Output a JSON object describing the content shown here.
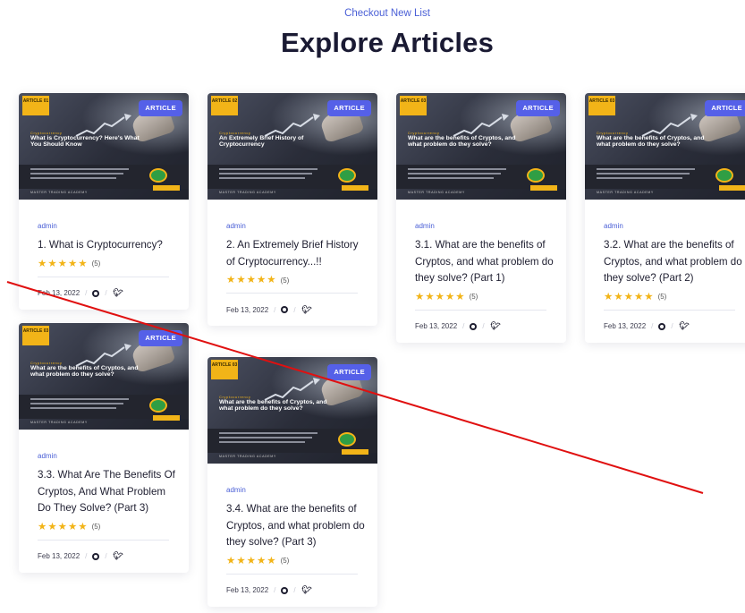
{
  "header": {
    "kicker": "Checkout New List",
    "title": "Explore Articles"
  },
  "colors": {
    "accent": "#4a5fd6",
    "badge": "#5560e8",
    "star": "#f2b418",
    "annotation_line": "#e01010"
  },
  "cards": [
    {
      "thumb": {
        "num": "ARTICLE 01",
        "badge": "ARTICLE",
        "kicker": "Cryptocurrency",
        "title": "What is Cryptocurrency? Here's What You Should Know",
        "footer": "MASTER TRADING ACADEMY"
      },
      "author": "admin",
      "title": "1. What is Cryptocurrency?",
      "rating_count": "(5)",
      "date": "Feb 13, 2022"
    },
    {
      "thumb": {
        "num": "ARTICLE 02",
        "badge": "ARTICLE",
        "kicker": "Cryptocurrency",
        "title": "An Extremely Brief History of Cryptocurrency",
        "footer": "MASTER TRADING ACADEMY"
      },
      "author": "admin",
      "title": "2. An Extremely Brief History of Cryptocurrency...!!",
      "rating_count": "(5)",
      "date": "Feb 13, 2022"
    },
    {
      "thumb": {
        "num": "ARTICLE 03",
        "badge": "ARTICLE",
        "kicker": "Cryptocurrency",
        "title": "What are the benefits of Cryptos, and what problem do they solve?",
        "footer": "MASTER TRADING ACADEMY"
      },
      "author": "admin",
      "title": "3.1. What are the benefits of Cryptos, and what problem do they solve? (Part 1)",
      "rating_count": "(5)",
      "date": "Feb 13, 2022"
    },
    {
      "thumb": {
        "num": "ARTICLE 03",
        "badge": "ARTICLE",
        "kicker": "Cryptocurrency",
        "title": "What are the benefits of Cryptos, and what problem do they solve?",
        "footer": "MASTER TRADING ACADEMY"
      },
      "author": "admin",
      "title": "3.2. What are the benefits of Cryptos, and what problem do they solve? (Part 2)",
      "rating_count": "(5)",
      "date": "Feb 13, 2022"
    },
    {
      "thumb": {
        "num": "ARTICLE 03",
        "badge": "ARTICLE",
        "kicker": "Cryptocurrency",
        "title": "What are the benefits of Cryptos, and what problem do they solve?",
        "footer": "MASTER TRADING ACADEMY"
      },
      "author": "admin",
      "title": "3.3. What Are The Benefits Of Cryptos, And What Problem Do They Solve? (Part 3)",
      "rating_count": "(5)",
      "date": "Feb 13, 2022"
    },
    {
      "thumb": {
        "num": "ARTICLE 03",
        "badge": "ARTICLE",
        "kicker": "Cryptocurrency",
        "title": "What are the benefits of Cryptos, and what problem do they solve?",
        "footer": "MASTER TRADING ACADEMY"
      },
      "author": "admin",
      "title": "3.4. What are the benefits of Cryptos, and what problem do they solve? (Part 3)",
      "rating_count": "(5)",
      "date": "Feb 13, 2022"
    }
  ]
}
